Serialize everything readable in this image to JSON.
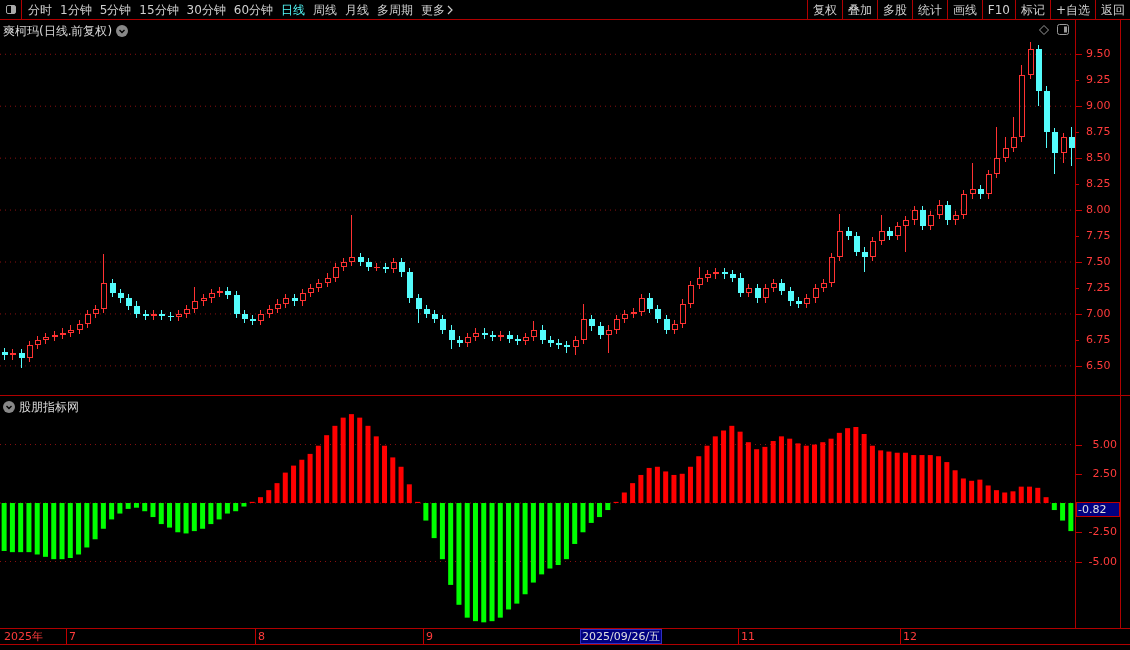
{
  "toolbar": {
    "tabs": [
      {
        "label": "分时",
        "selected": false
      },
      {
        "label": "1分钟",
        "selected": false
      },
      {
        "label": "5分钟",
        "selected": false
      },
      {
        "label": "15分钟",
        "selected": false
      },
      {
        "label": "30分钟",
        "selected": false
      },
      {
        "label": "60分钟",
        "selected": false
      },
      {
        "label": "日线",
        "selected": true
      },
      {
        "label": "周线",
        "selected": false
      },
      {
        "label": "月线",
        "selected": false
      },
      {
        "label": "多周期",
        "selected": false
      }
    ],
    "more": "更多",
    "buttons": [
      "复权",
      "叠加",
      "多股",
      "统计",
      "画线",
      "F10",
      "标记",
      "+自选",
      "返回"
    ]
  },
  "price_panel": {
    "title": "爽柯玛(日线.前复权)",
    "chart_data": {
      "type": "candlestick",
      "grid": true,
      "ylim": [
        6.21,
        9.83
      ],
      "yticks": [
        {
          "value": 9.5,
          "label": "9.50"
        },
        {
          "value": 9.25,
          "label": "9.25"
        },
        {
          "value": 9,
          "label": "9.00"
        },
        {
          "value": 8.75,
          "label": "8.75"
        },
        {
          "value": 8.5,
          "label": "8.50"
        },
        {
          "value": 8.25,
          "label": "8.25"
        },
        {
          "value": 8,
          "label": "8.00"
        },
        {
          "value": 7.75,
          "label": "7.75"
        },
        {
          "value": 7.5,
          "label": "7.50"
        },
        {
          "value": 7.25,
          "label": "7.25"
        },
        {
          "value": 7,
          "label": "7.00"
        },
        {
          "value": 6.75,
          "label": "6.75"
        },
        {
          "value": 6.5,
          "label": "6.50"
        }
      ],
      "ohlc": [
        [
          6.63,
          6.67,
          6.56,
          6.6
        ],
        [
          6.6,
          6.66,
          6.56,
          6.62
        ],
        [
          6.62,
          6.66,
          6.48,
          6.58
        ],
        [
          6.58,
          6.74,
          6.54,
          6.7
        ],
        [
          6.7,
          6.79,
          6.66,
          6.75
        ],
        [
          6.75,
          6.82,
          6.71,
          6.78
        ],
        [
          6.78,
          6.84,
          6.74,
          6.8
        ],
        [
          6.8,
          6.86,
          6.76,
          6.82
        ],
        [
          6.82,
          6.89,
          6.78,
          6.85
        ],
        [
          6.85,
          6.94,
          6.81,
          6.9
        ],
        [
          6.9,
          7.04,
          6.86,
          7.0
        ],
        [
          7.0,
          7.09,
          6.96,
          7.05
        ],
        [
          7.05,
          7.58,
          7.01,
          7.3
        ],
        [
          7.3,
          7.34,
          7.16,
          7.2
        ],
        [
          7.2,
          7.24,
          7.11,
          7.15
        ],
        [
          7.15,
          7.19,
          7.04,
          7.08
        ],
        [
          7.08,
          7.12,
          6.96,
          7.0
        ],
        [
          7.0,
          7.04,
          6.94,
          6.98
        ],
        [
          6.98,
          7.04,
          6.94,
          7.0
        ],
        [
          7.0,
          7.04,
          6.94,
          6.98
        ],
        [
          6.98,
          7.02,
          6.93,
          6.97
        ],
        [
          6.97,
          7.04,
          6.93,
          7.0
        ],
        [
          7.0,
          7.09,
          6.96,
          7.05
        ],
        [
          7.05,
          7.26,
          7.01,
          7.12
        ],
        [
          7.12,
          7.19,
          7.08,
          7.15
        ],
        [
          7.15,
          7.24,
          7.11,
          7.2
        ],
        [
          7.2,
          7.26,
          7.16,
          7.22
        ],
        [
          7.22,
          7.26,
          7.14,
          7.18
        ],
        [
          7.18,
          7.22,
          6.96,
          7.0
        ],
        [
          7.0,
          7.04,
          6.91,
          6.95
        ],
        [
          6.95,
          6.99,
          6.89,
          6.93
        ],
        [
          6.93,
          7.04,
          6.89,
          7.0
        ],
        [
          7.0,
          7.09,
          6.96,
          7.05
        ],
        [
          7.05,
          7.14,
          7.01,
          7.1
        ],
        [
          7.1,
          7.19,
          7.06,
          7.15
        ],
        [
          7.15,
          7.19,
          7.08,
          7.12
        ],
        [
          7.12,
          7.24,
          7.08,
          7.2
        ],
        [
          7.2,
          7.29,
          7.16,
          7.25
        ],
        [
          7.25,
          7.34,
          7.21,
          7.3
        ],
        [
          7.3,
          7.39,
          7.26,
          7.35
        ],
        [
          7.35,
          7.49,
          7.31,
          7.45
        ],
        [
          7.45,
          7.54,
          7.41,
          7.5
        ],
        [
          7.5,
          7.95,
          7.46,
          7.55
        ],
        [
          7.55,
          7.59,
          7.46,
          7.5
        ],
        [
          7.5,
          7.54,
          7.41,
          7.45
        ],
        [
          7.45,
          7.49,
          7.41,
          7.45
        ],
        [
          7.45,
          7.49,
          7.39,
          7.43
        ],
        [
          7.43,
          7.54,
          7.39,
          7.5
        ],
        [
          7.5,
          7.54,
          7.36,
          7.4
        ],
        [
          7.4,
          7.44,
          7.11,
          7.15
        ],
        [
          7.15,
          7.19,
          6.91,
          7.05
        ],
        [
          7.05,
          7.09,
          6.96,
          7.0
        ],
        [
          7.0,
          7.04,
          6.91,
          6.95
        ],
        [
          6.95,
          6.99,
          6.81,
          6.85
        ],
        [
          6.85,
          6.89,
          6.66,
          6.75
        ],
        [
          6.75,
          6.79,
          6.68,
          6.72
        ],
        [
          6.72,
          6.82,
          6.68,
          6.78
        ],
        [
          6.78,
          6.86,
          6.74,
          6.82
        ],
        [
          6.82,
          6.86,
          6.76,
          6.8
        ],
        [
          6.8,
          6.84,
          6.74,
          6.78
        ],
        [
          6.78,
          6.84,
          6.74,
          6.8
        ],
        [
          6.8,
          6.84,
          6.72,
          6.76
        ],
        [
          6.76,
          6.8,
          6.7,
          6.74
        ],
        [
          6.74,
          6.82,
          6.7,
          6.78
        ],
        [
          6.78,
          6.93,
          6.74,
          6.85
        ],
        [
          6.85,
          6.89,
          6.71,
          6.75
        ],
        [
          6.75,
          6.79,
          6.68,
          6.72
        ],
        [
          6.72,
          6.76,
          6.66,
          6.7
        ],
        [
          6.7,
          6.74,
          6.62,
          6.68
        ],
        [
          6.68,
          6.79,
          6.6,
          6.75
        ],
        [
          6.75,
          7.1,
          6.71,
          6.95
        ],
        [
          6.95,
          6.99,
          6.84,
          6.88
        ],
        [
          6.88,
          6.92,
          6.76,
          6.8
        ],
        [
          6.8,
          6.89,
          6.62,
          6.85
        ],
        [
          6.85,
          6.99,
          6.81,
          6.95
        ],
        [
          6.95,
          7.04,
          6.91,
          7.0
        ],
        [
          7.0,
          7.06,
          6.96,
          7.02
        ],
        [
          7.02,
          7.19,
          6.98,
          7.15
        ],
        [
          7.15,
          7.2,
          7.01,
          7.05
        ],
        [
          7.05,
          7.09,
          6.91,
          6.95
        ],
        [
          6.95,
          6.99,
          6.81,
          6.85
        ],
        [
          6.85,
          6.94,
          6.81,
          6.9
        ],
        [
          6.9,
          7.14,
          6.86,
          7.1
        ],
        [
          7.1,
          7.32,
          7.06,
          7.28
        ],
        [
          7.28,
          7.45,
          7.24,
          7.35
        ],
        [
          7.35,
          7.42,
          7.31,
          7.38
        ],
        [
          7.38,
          7.44,
          7.34,
          7.4
        ],
        [
          7.4,
          7.44,
          7.34,
          7.38
        ],
        [
          7.38,
          7.42,
          7.31,
          7.35
        ],
        [
          7.35,
          7.39,
          7.16,
          7.2
        ],
        [
          7.2,
          7.29,
          7.16,
          7.25
        ],
        [
          7.25,
          7.29,
          7.11,
          7.15
        ],
        [
          7.15,
          7.29,
          7.11,
          7.25
        ],
        [
          7.25,
          7.34,
          7.21,
          7.3
        ],
        [
          7.3,
          7.34,
          7.18,
          7.22
        ],
        [
          7.22,
          7.26,
          7.08,
          7.12
        ],
        [
          7.12,
          7.16,
          7.06,
          7.1
        ],
        [
          7.1,
          7.19,
          7.06,
          7.15
        ],
        [
          7.15,
          7.29,
          7.11,
          7.25
        ],
        [
          7.25,
          7.34,
          7.21,
          7.3
        ],
        [
          7.3,
          7.59,
          7.26,
          7.55
        ],
        [
          7.55,
          7.96,
          7.51,
          7.8
        ],
        [
          7.8,
          7.84,
          7.71,
          7.75
        ],
        [
          7.75,
          7.79,
          7.56,
          7.6
        ],
        [
          7.6,
          7.64,
          7.4,
          7.55
        ],
        [
          7.55,
          7.74,
          7.51,
          7.7
        ],
        [
          7.7,
          7.95,
          7.66,
          7.8
        ],
        [
          7.8,
          7.84,
          7.71,
          7.75
        ],
        [
          7.75,
          7.89,
          7.71,
          7.85
        ],
        [
          7.85,
          7.94,
          7.6,
          7.9
        ],
        [
          7.9,
          8.04,
          7.86,
          8.0
        ],
        [
          8.0,
          8.04,
          7.81,
          7.85
        ],
        [
          7.85,
          7.99,
          7.81,
          7.95
        ],
        [
          7.95,
          8.1,
          7.91,
          8.05
        ],
        [
          8.05,
          8.09,
          7.86,
          7.9
        ],
        [
          7.9,
          7.99,
          7.86,
          7.95
        ],
        [
          7.95,
          8.19,
          7.91,
          8.15
        ],
        [
          8.15,
          8.45,
          8.11,
          8.2
        ],
        [
          8.2,
          8.24,
          8.11,
          8.15
        ],
        [
          8.15,
          8.39,
          8.11,
          8.35
        ],
        [
          8.35,
          8.8,
          8.31,
          8.5
        ],
        [
          8.5,
          8.7,
          8.46,
          8.6
        ],
        [
          8.6,
          8.9,
          8.56,
          8.7
        ],
        [
          8.7,
          9.4,
          8.66,
          9.3
        ],
        [
          9.3,
          9.62,
          9.26,
          9.55
        ],
        [
          9.55,
          9.59,
          9.0,
          9.15
        ],
        [
          9.15,
          9.19,
          8.6,
          8.75
        ],
        [
          8.75,
          8.79,
          8.35,
          8.55
        ],
        [
          8.55,
          8.74,
          8.45,
          8.7
        ],
        [
          8.7,
          8.8,
          8.42,
          8.6
        ]
      ]
    }
  },
  "indicator_panel": {
    "title": "股朋指标网",
    "current_value": "-0.82",
    "chart_data": {
      "type": "bar",
      "stacked": true,
      "grid": true,
      "ylim": [
        -10.77,
        9.15
      ],
      "yticks": [
        {
          "value": 5,
          "label": "5.00"
        },
        {
          "value": 2.5,
          "label": "2.50"
        },
        {
          "value": -2.5,
          "label": "-2.50"
        },
        {
          "value": -5,
          "label": "-5.00"
        }
      ],
      "series": [
        {
          "color": "#ff0000",
          "values": [
            null,
            null,
            null,
            null,
            null,
            null,
            null,
            null,
            null,
            null,
            null,
            null,
            null,
            null,
            null,
            null,
            null,
            null,
            null,
            null,
            null,
            null,
            null,
            null,
            null,
            null,
            null,
            null,
            null,
            null,
            0.1,
            0.5,
            1.1,
            1.7,
            2.6,
            3.2,
            3.7,
            4.2,
            4.9,
            5.8,
            6.6,
            7.3,
            7.6,
            7.3,
            6.6,
            5.7,
            4.9,
            3.9,
            3.1,
            1.6,
            0.1,
            null,
            null,
            null,
            null,
            null,
            null,
            null,
            null,
            null,
            null,
            null,
            null,
            null,
            null,
            null,
            null,
            null,
            null,
            null,
            null,
            null,
            null,
            null,
            0.1,
            0.9,
            1.7,
            2.4,
            3.0,
            3.1,
            2.7,
            2.4,
            2.5,
            3.1,
            4.0,
            4.9,
            5.7,
            6.2,
            6.6,
            6.1,
            5.2,
            4.6,
            4.8,
            5.3,
            5.7,
            5.5,
            5.1,
            4.9,
            5.0,
            5.2,
            5.5,
            6.0,
            6.4,
            6.5,
            5.9,
            4.9,
            4.5,
            4.4,
            4.3,
            4.3,
            4.1,
            4.1,
            4.1,
            4.0,
            3.5,
            2.8,
            2.1,
            1.9,
            2.0,
            1.5,
            1.1,
            0.9,
            1.0,
            1.4,
            1.4,
            1.3,
            0.5,
            null,
            null,
            null
          ]
        },
        {
          "color": "#00ff00",
          "values": [
            -4.1,
            -4.2,
            -4.2,
            -4.2,
            -4.4,
            -4.6,
            -4.8,
            -4.8,
            -4.7,
            -4.4,
            -3.8,
            -3.1,
            -2.2,
            -1.4,
            -0.9,
            -0.5,
            -0.4,
            -0.7,
            -1.2,
            -1.8,
            -2.1,
            -2.5,
            -2.6,
            -2.4,
            -2.2,
            -1.8,
            -1.4,
            -0.9,
            -0.7,
            -0.3,
            null,
            null,
            null,
            null,
            null,
            null,
            null,
            null,
            null,
            null,
            null,
            null,
            null,
            null,
            null,
            null,
            null,
            null,
            null,
            null,
            null,
            -1.5,
            -3.0,
            -4.8,
            -7.0,
            -8.7,
            -9.8,
            -10.1,
            -10.2,
            -10.1,
            -9.8,
            -9.1,
            -8.6,
            -7.8,
            -6.8,
            -6.1,
            -5.6,
            -5.3,
            -4.8,
            -3.5,
            -2.5,
            -1.7,
            -1.2,
            -0.6,
            null,
            null,
            null,
            null,
            null,
            null,
            null,
            null,
            null,
            null,
            null,
            null,
            null,
            null,
            null,
            null,
            null,
            null,
            null,
            null,
            null,
            null,
            null,
            null,
            null,
            null,
            null,
            null,
            null,
            null,
            null,
            null,
            null,
            null,
            null,
            null,
            null,
            null,
            null,
            null,
            null,
            null,
            null,
            null,
            null,
            null,
            null,
            null,
            null,
            null,
            null,
            null,
            null,
            -0.6,
            -1.5,
            -2.4
          ]
        }
      ]
    }
  },
  "time_axis": {
    "year": "2025年",
    "months": [
      "7",
      "8",
      "9",
      "11",
      "12"
    ],
    "cursor_date": "2025/09/26/五"
  }
}
